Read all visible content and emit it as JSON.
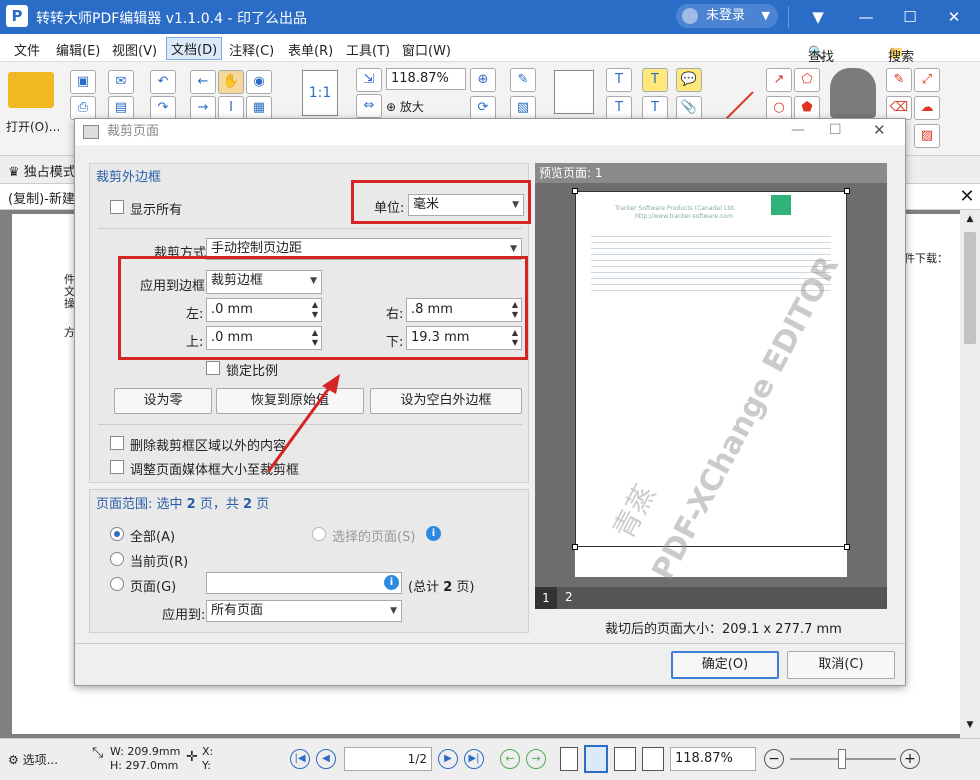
{
  "app": {
    "logo_letter": "P",
    "title": "转转大师PDF编辑器 v1.1.0.4 - 印了么出品",
    "user": "未登录"
  },
  "menu": [
    "文件",
    "编辑(E)",
    "视图(V)",
    "文档(D)",
    "注释(C)",
    "表单(R)",
    "工具(T)",
    "窗口(W)"
  ],
  "menu_right": {
    "find": "查找(F)...",
    "search": "搜索(S)..."
  },
  "toolbar": {
    "open_label": "打开(O)...",
    "zoom": "118.87%",
    "zoom_in_label": "放大",
    "fit_label": "1:1"
  },
  "tabs": {
    "exclusive_mode": "独占模式",
    "doc_tab": "(复制)-新建"
  },
  "doc_text": {
    "right_text": "件下载：",
    "left_lines": [
      "件",
      "文",
      "操",
      "方"
    ]
  },
  "dialog": {
    "title": "裁剪页面",
    "crop_margins_header": "裁剪外边框",
    "show_all": "显示所有",
    "unit_label": "单位:",
    "unit_value": "毫米",
    "crop_method_label": "裁剪方式",
    "crop_method_value": "手动控制页边距",
    "apply_to_box_label": "应用到边框",
    "apply_to_box_value": "裁剪边框",
    "left_label": "左:",
    "left_value": ".0 mm",
    "right_label": "右:",
    "right_value": ".8 mm",
    "top_label": "上:",
    "top_value": ".0 mm",
    "bottom_label": "下:",
    "bottom_value": "19.3 mm",
    "lock_ratio": "锁定比例",
    "btn_zero": "设为零",
    "btn_restore": "恢复到原始值",
    "btn_whitespace": "设为空白外边框",
    "delete_outside": "删除裁剪框区域以外的内容",
    "resize_media": "调整页面媒体框大小至裁剪框",
    "page_range_prefix": "页面范围: 选中",
    "page_range_sel": "2",
    "page_range_mid": "页，共",
    "page_range_total": "2",
    "page_range_suffix": "页",
    "radio_all": "全部(A)",
    "radio_selected": "选择的页面(S)",
    "radio_current": "当前页(R)",
    "radio_pages": "页面(G)",
    "total_pages_prefix": "(总计",
    "total_pages_num": "2",
    "total_pages_suffix": "页)",
    "apply_to_label": "应用到:",
    "apply_to_value": "所有页面",
    "preview_header": "预览页面: 1",
    "preview_tabs": [
      "1",
      "2"
    ],
    "cropped_size": "裁切后的页面大小：209.1 x 277.7 mm",
    "ok": "确定(O)",
    "cancel": "取消(C)"
  },
  "preview_doc": {
    "line1": "Tracker Software Products (Canada) Ltd.",
    "line2": "http://www.tracker-software.com",
    "watermark": "PDF-XChange EDITOR",
    "watermark2": "青蒸"
  },
  "status": {
    "select_label": "选项...",
    "width": "W: 209.9mm",
    "height": "H: 297.0mm",
    "x": "X:",
    "y": "Y:",
    "page": "1",
    "page_total": "2",
    "zoom": "118.87%"
  }
}
